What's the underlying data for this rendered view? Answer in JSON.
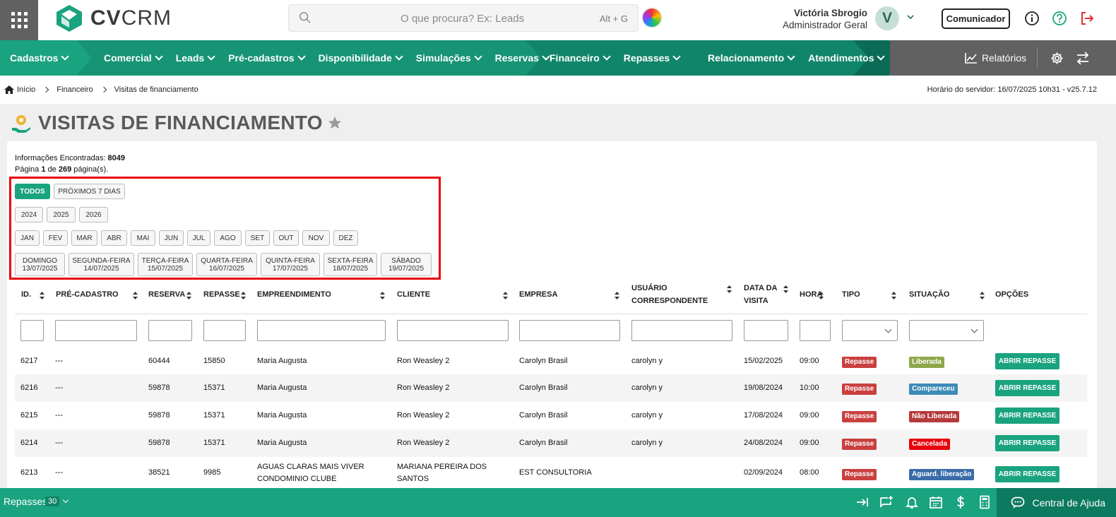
{
  "app": {
    "logo_text_bold": "CV",
    "logo_text_rest": "CRM"
  },
  "search": {
    "placeholder": "O que procura? Ex: Leads",
    "shortcut": "Alt + G"
  },
  "user": {
    "name": "Victória Sbrogio",
    "role": "Administrador Geral",
    "initial": "V"
  },
  "header": {
    "communicator_label": "Comunicador"
  },
  "nav": {
    "items": [
      "Cadastros",
      "Comercial",
      "Leads",
      "Pré-cadastros",
      "Disponibilidade",
      "Simulações",
      "Reservas",
      "Financeiro",
      "Repasses",
      "Relacionamento",
      "Atendimentos"
    ],
    "reports": "Relatórios"
  },
  "breadcrumb": {
    "items": [
      "Início",
      "Financeiro",
      "Visitas de financiamento"
    ],
    "server_time": "Horário do servidor: 16/07/2025 10h31 - v25.7.12"
  },
  "page": {
    "title": "VISITAS DE FINANCIAMENTO"
  },
  "info": {
    "found_label": "Informações Encontradas:",
    "found_count": "8049",
    "page_prefix": "Página",
    "page_current": "1",
    "page_of": "de",
    "page_total": "269",
    "page_suffix": "página(s)."
  },
  "filters": {
    "period": [
      "TODOS",
      "PRÓXIMOS 7 DIAS"
    ],
    "years": [
      "2024",
      "2025",
      "2026"
    ],
    "months": [
      "JAN",
      "FEV",
      "MAR",
      "ABR",
      "MAI",
      "JUN",
      "JUL",
      "AGO",
      "SET",
      "OUT",
      "NOV",
      "DEZ"
    ],
    "days": [
      {
        "name": "DOMINGO",
        "date": "13/07/2025"
      },
      {
        "name": "SEGUNDA-FEIRA",
        "date": "14/07/2025"
      },
      {
        "name": "TERÇA-FEIRA",
        "date": "15/07/2025"
      },
      {
        "name": "QUARTA-FEIRA",
        "date": "16/07/2025"
      },
      {
        "name": "QUINTA-FEIRA",
        "date": "17/07/2025"
      },
      {
        "name": "SEXTA-FEIRA",
        "date": "18/07/2025"
      },
      {
        "name": "SÁBADO",
        "date": "19/07/2025"
      }
    ]
  },
  "table": {
    "headers": [
      "ID.",
      "PRÉ-CADASTRO",
      "RESERVA",
      "REPASSE",
      "EMPREENDIMENTO",
      "CLIENTE",
      "EMPRESA",
      "USUÁRIO",
      "CORRESPONDENTE",
      "DATA DA",
      "VISITA",
      "HORA",
      "TIPO",
      "SITUAÇÃO",
      "OPÇÕES"
    ],
    "rows": [
      {
        "id": "6217",
        "pre": "---",
        "reserva": "60444",
        "repasse": "15850",
        "emp": "Maria Augusta",
        "emp2": "",
        "cli": "Ron Weasley 2",
        "cli2": "",
        "empresa": "Carolyn Brasil",
        "usuario": "carolyn y",
        "data": "15/02/2025",
        "hora": "09:00",
        "tipo": "Repasse",
        "situacao": "Liberada",
        "opcao": "ABRIR REPASSE"
      },
      {
        "id": "6216",
        "pre": "---",
        "reserva": "59878",
        "repasse": "15371",
        "emp": "Maria Augusta",
        "emp2": "",
        "cli": "Ron Weasley 2",
        "cli2": "",
        "empresa": "Carolyn Brasil",
        "usuario": "carolyn y",
        "data": "19/08/2024",
        "hora": "10:00",
        "tipo": "Repasse",
        "situacao": "Compareceu",
        "opcao": "ABRIR REPASSE"
      },
      {
        "id": "6215",
        "pre": "---",
        "reserva": "59878",
        "repasse": "15371",
        "emp": "Maria Augusta",
        "emp2": "",
        "cli": "Ron Weasley 2",
        "cli2": "",
        "empresa": "Carolyn Brasil",
        "usuario": "carolyn y",
        "data": "17/08/2024",
        "hora": "09:00",
        "tipo": "Repasse",
        "situacao": "Não Liberada",
        "opcao": "ABRIR REPASSE"
      },
      {
        "id": "6214",
        "pre": "---",
        "reserva": "59878",
        "repasse": "15371",
        "emp": "Maria Augusta",
        "emp2": "",
        "cli": "Ron Weasley 2",
        "cli2": "",
        "empresa": "Carolyn Brasil",
        "usuario": "carolyn y",
        "data": "24/08/2024",
        "hora": "09:00",
        "tipo": "Repasse",
        "situacao": "Cancelada",
        "opcao": "ABRIR REPASSE"
      },
      {
        "id": "6213",
        "pre": "---",
        "reserva": "38521",
        "repasse": "9985",
        "emp": "AGUAS CLARAS MAIS VIVER",
        "emp2": "CONDOMINIO CLUBE",
        "cli": "MARIANA PEREIRA DOS",
        "cli2": "SANTOS",
        "empresa": "EST CONSULTORIA",
        "usuario": "",
        "data": "02/09/2024",
        "hora": "08:00",
        "tipo": "Repasse",
        "situacao": "Aguard. liberação",
        "opcao": "ABRIR REPASSE"
      }
    ]
  },
  "footer": {
    "label": "Repasses",
    "count": "30",
    "help": "Central de Ajuda"
  },
  "colors": {
    "brand": "#1aa37f",
    "tipo": "#c9403f",
    "liberada": "#8ea84a",
    "compareceu": "#3d8bb8",
    "nao_liberada": "#b53a3a",
    "cancelada": "#e8000b",
    "aguardando": "#3a6ba8"
  }
}
